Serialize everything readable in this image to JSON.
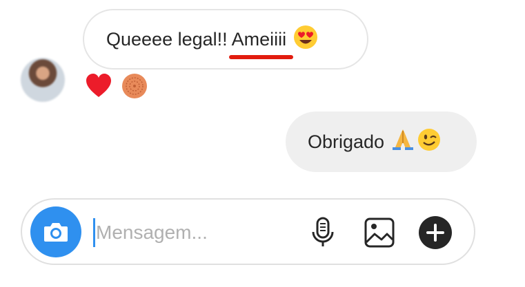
{
  "messages": {
    "received": {
      "text_before": "Queeee legal!! ",
      "highlight": "Ameiiii",
      "emoji_icon": "heart-eyes-emoji-icon"
    },
    "reactions": [
      "heart-reaction-icon",
      "cookie-reaction-icon"
    ],
    "sent": {
      "text": "Obrigado",
      "emoji_icons": [
        "folded-hands-emoji-icon",
        "winking-face-emoji-icon"
      ]
    }
  },
  "composer": {
    "placeholder": "Mensagem...",
    "accent_color": "#2f90ef"
  },
  "colors": {
    "underline": "#e21c0e",
    "heart": "#ec1c2a",
    "sent_bubble": "#efefef"
  }
}
